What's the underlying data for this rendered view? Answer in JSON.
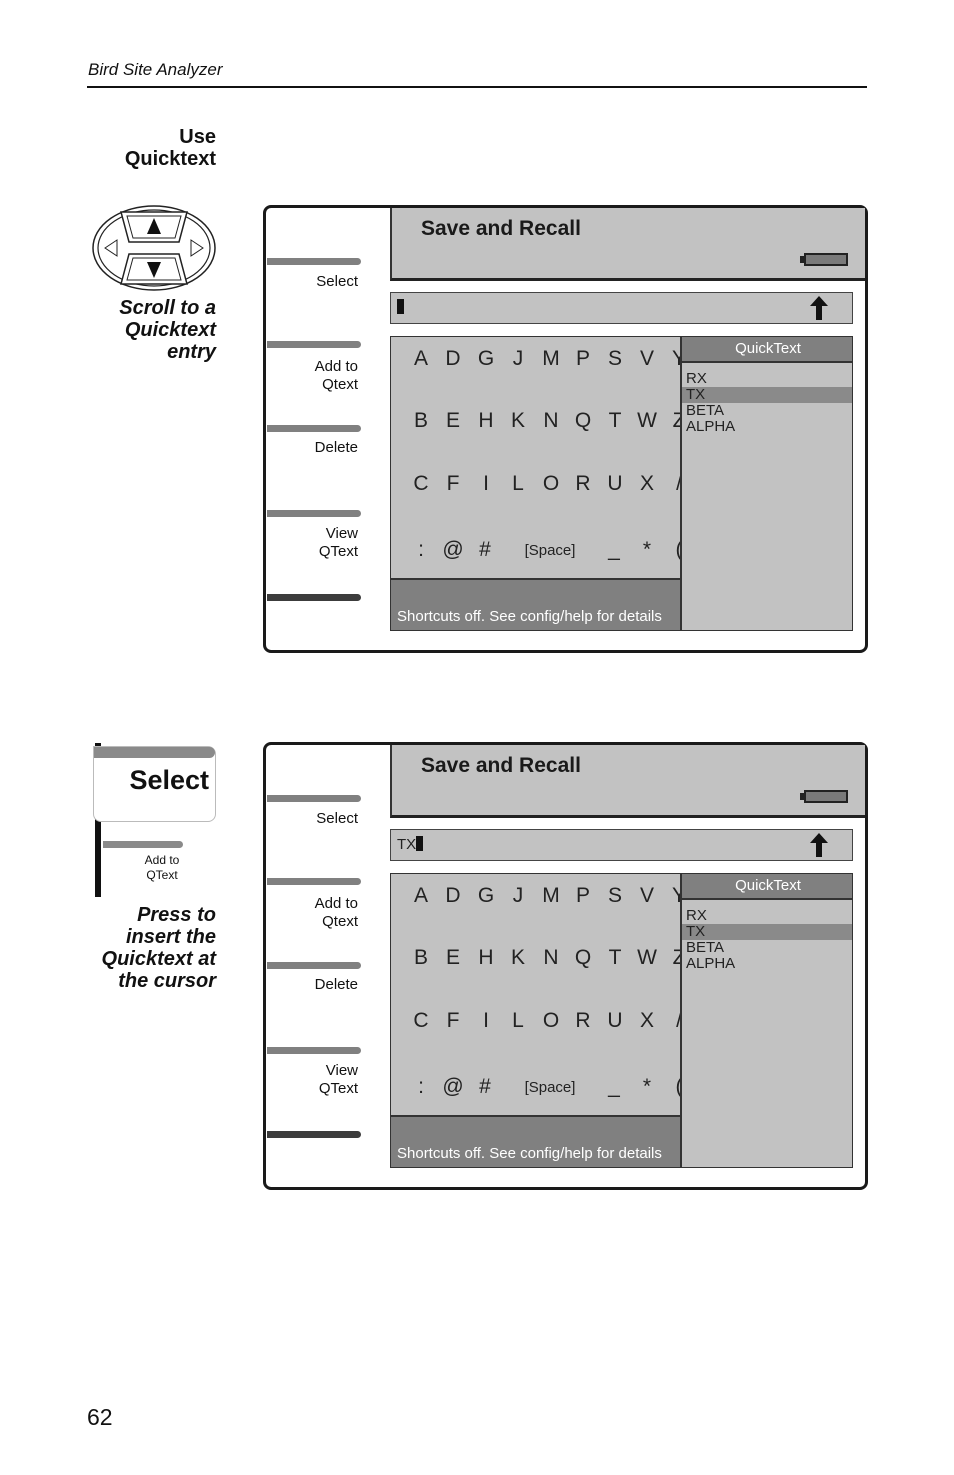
{
  "running_head": "Bird Site Analyzer",
  "page_number": "62",
  "step1": {
    "heading_line1": "Use",
    "heading_line2": "Quicktext",
    "caption_lines": [
      "Scroll to a",
      "Quicktext",
      "entry"
    ],
    "keypad_icon": "arrow-keypad-icon"
  },
  "step2": {
    "key_label": "Select",
    "key_sublabel_line1": "Add to",
    "key_sublabel_line2": "QText",
    "caption_lines": [
      "Press to",
      "insert the",
      "Quicktext at",
      "the cursor"
    ]
  },
  "panels": [
    {
      "title": "Save and Recall",
      "softkeys": [
        {
          "l1": "Select",
          "l2": ""
        },
        {
          "l1": "Add to",
          "l2": "Qtext"
        },
        {
          "l1": "Delete",
          "l2": ""
        },
        {
          "l1": "View",
          "l2": "QText"
        }
      ],
      "input_text": "",
      "keyboard_rows": [
        [
          "A",
          "D",
          "G",
          "J",
          "M",
          "P",
          "S",
          "V",
          "Y"
        ],
        [
          "B",
          "E",
          "H",
          "K",
          "N",
          "Q",
          "T",
          "W",
          "Z"
        ],
        [
          "C",
          "F",
          "I",
          "L",
          "O",
          "R",
          "U",
          "X",
          "/"
        ],
        [
          ":",
          "@",
          "#",
          "[Space]",
          "_",
          "*",
          "("
        ]
      ],
      "status": "Shortcuts off. See config/help for details",
      "quicktext": {
        "header": "QuickText",
        "items": [
          "RX",
          "TX",
          "BETA",
          "ALPHA"
        ],
        "selected": "TX"
      }
    },
    {
      "title": "Save and Recall",
      "softkeys": [
        {
          "l1": "Select",
          "l2": ""
        },
        {
          "l1": "Add to",
          "l2": "Qtext"
        },
        {
          "l1": "Delete",
          "l2": ""
        },
        {
          "l1": "View",
          "l2": "QText"
        }
      ],
      "input_text": "TX",
      "keyboard_rows": [
        [
          "A",
          "D",
          "G",
          "J",
          "M",
          "P",
          "S",
          "V",
          "Y"
        ],
        [
          "B",
          "E",
          "H",
          "K",
          "N",
          "Q",
          "T",
          "W",
          "Z"
        ],
        [
          "C",
          "F",
          "I",
          "L",
          "O",
          "R",
          "U",
          "X",
          "/"
        ],
        [
          ":",
          "@",
          "#",
          "[Space]",
          "_",
          "*",
          "("
        ]
      ],
      "status": "Shortcuts off. See config/help for details",
      "quicktext": {
        "header": "QuickText",
        "items": [
          "RX",
          "TX",
          "BETA",
          "ALPHA"
        ],
        "selected": "TX"
      }
    }
  ],
  "colors": {
    "screen_gray": "#c2c2c2",
    "dark_gray": "#808080",
    "frame": "#1a1a1a"
  }
}
